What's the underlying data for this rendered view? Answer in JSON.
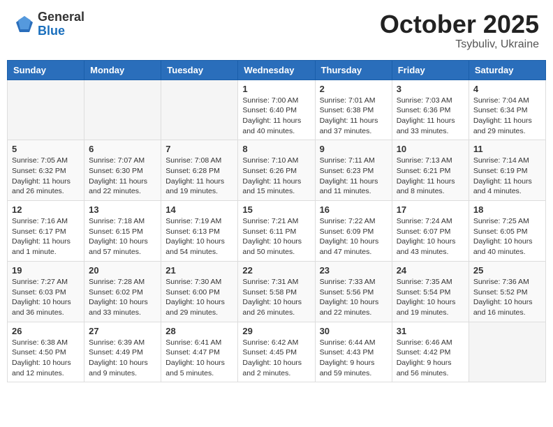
{
  "header": {
    "logo_general": "General",
    "logo_blue": "Blue",
    "month": "October 2025",
    "location": "Tsybuliv, Ukraine"
  },
  "weekdays": [
    "Sunday",
    "Monday",
    "Tuesday",
    "Wednesday",
    "Thursday",
    "Friday",
    "Saturday"
  ],
  "weeks": [
    [
      {
        "day": "",
        "info": ""
      },
      {
        "day": "",
        "info": ""
      },
      {
        "day": "",
        "info": ""
      },
      {
        "day": "1",
        "info": "Sunrise: 7:00 AM\nSunset: 6:40 PM\nDaylight: 11 hours\nand 40 minutes."
      },
      {
        "day": "2",
        "info": "Sunrise: 7:01 AM\nSunset: 6:38 PM\nDaylight: 11 hours\nand 37 minutes."
      },
      {
        "day": "3",
        "info": "Sunrise: 7:03 AM\nSunset: 6:36 PM\nDaylight: 11 hours\nand 33 minutes."
      },
      {
        "day": "4",
        "info": "Sunrise: 7:04 AM\nSunset: 6:34 PM\nDaylight: 11 hours\nand 29 minutes."
      }
    ],
    [
      {
        "day": "5",
        "info": "Sunrise: 7:05 AM\nSunset: 6:32 PM\nDaylight: 11 hours\nand 26 minutes."
      },
      {
        "day": "6",
        "info": "Sunrise: 7:07 AM\nSunset: 6:30 PM\nDaylight: 11 hours\nand 22 minutes."
      },
      {
        "day": "7",
        "info": "Sunrise: 7:08 AM\nSunset: 6:28 PM\nDaylight: 11 hours\nand 19 minutes."
      },
      {
        "day": "8",
        "info": "Sunrise: 7:10 AM\nSunset: 6:26 PM\nDaylight: 11 hours\nand 15 minutes."
      },
      {
        "day": "9",
        "info": "Sunrise: 7:11 AM\nSunset: 6:23 PM\nDaylight: 11 hours\nand 11 minutes."
      },
      {
        "day": "10",
        "info": "Sunrise: 7:13 AM\nSunset: 6:21 PM\nDaylight: 11 hours\nand 8 minutes."
      },
      {
        "day": "11",
        "info": "Sunrise: 7:14 AM\nSunset: 6:19 PM\nDaylight: 11 hours\nand 4 minutes."
      }
    ],
    [
      {
        "day": "12",
        "info": "Sunrise: 7:16 AM\nSunset: 6:17 PM\nDaylight: 11 hours\nand 1 minute."
      },
      {
        "day": "13",
        "info": "Sunrise: 7:18 AM\nSunset: 6:15 PM\nDaylight: 10 hours\nand 57 minutes."
      },
      {
        "day": "14",
        "info": "Sunrise: 7:19 AM\nSunset: 6:13 PM\nDaylight: 10 hours\nand 54 minutes."
      },
      {
        "day": "15",
        "info": "Sunrise: 7:21 AM\nSunset: 6:11 PM\nDaylight: 10 hours\nand 50 minutes."
      },
      {
        "day": "16",
        "info": "Sunrise: 7:22 AM\nSunset: 6:09 PM\nDaylight: 10 hours\nand 47 minutes."
      },
      {
        "day": "17",
        "info": "Sunrise: 7:24 AM\nSunset: 6:07 PM\nDaylight: 10 hours\nand 43 minutes."
      },
      {
        "day": "18",
        "info": "Sunrise: 7:25 AM\nSunset: 6:05 PM\nDaylight: 10 hours\nand 40 minutes."
      }
    ],
    [
      {
        "day": "19",
        "info": "Sunrise: 7:27 AM\nSunset: 6:03 PM\nDaylight: 10 hours\nand 36 minutes."
      },
      {
        "day": "20",
        "info": "Sunrise: 7:28 AM\nSunset: 6:02 PM\nDaylight: 10 hours\nand 33 minutes."
      },
      {
        "day": "21",
        "info": "Sunrise: 7:30 AM\nSunset: 6:00 PM\nDaylight: 10 hours\nand 29 minutes."
      },
      {
        "day": "22",
        "info": "Sunrise: 7:31 AM\nSunset: 5:58 PM\nDaylight: 10 hours\nand 26 minutes."
      },
      {
        "day": "23",
        "info": "Sunrise: 7:33 AM\nSunset: 5:56 PM\nDaylight: 10 hours\nand 22 minutes."
      },
      {
        "day": "24",
        "info": "Sunrise: 7:35 AM\nSunset: 5:54 PM\nDaylight: 10 hours\nand 19 minutes."
      },
      {
        "day": "25",
        "info": "Sunrise: 7:36 AM\nSunset: 5:52 PM\nDaylight: 10 hours\nand 16 minutes."
      }
    ],
    [
      {
        "day": "26",
        "info": "Sunrise: 6:38 AM\nSunset: 4:50 PM\nDaylight: 10 hours\nand 12 minutes."
      },
      {
        "day": "27",
        "info": "Sunrise: 6:39 AM\nSunset: 4:49 PM\nDaylight: 10 hours\nand 9 minutes."
      },
      {
        "day": "28",
        "info": "Sunrise: 6:41 AM\nSunset: 4:47 PM\nDaylight: 10 hours\nand 5 minutes."
      },
      {
        "day": "29",
        "info": "Sunrise: 6:42 AM\nSunset: 4:45 PM\nDaylight: 10 hours\nand 2 minutes."
      },
      {
        "day": "30",
        "info": "Sunrise: 6:44 AM\nSunset: 4:43 PM\nDaylight: 9 hours\nand 59 minutes."
      },
      {
        "day": "31",
        "info": "Sunrise: 6:46 AM\nSunset: 4:42 PM\nDaylight: 9 hours\nand 56 minutes."
      },
      {
        "day": "",
        "info": ""
      }
    ]
  ]
}
